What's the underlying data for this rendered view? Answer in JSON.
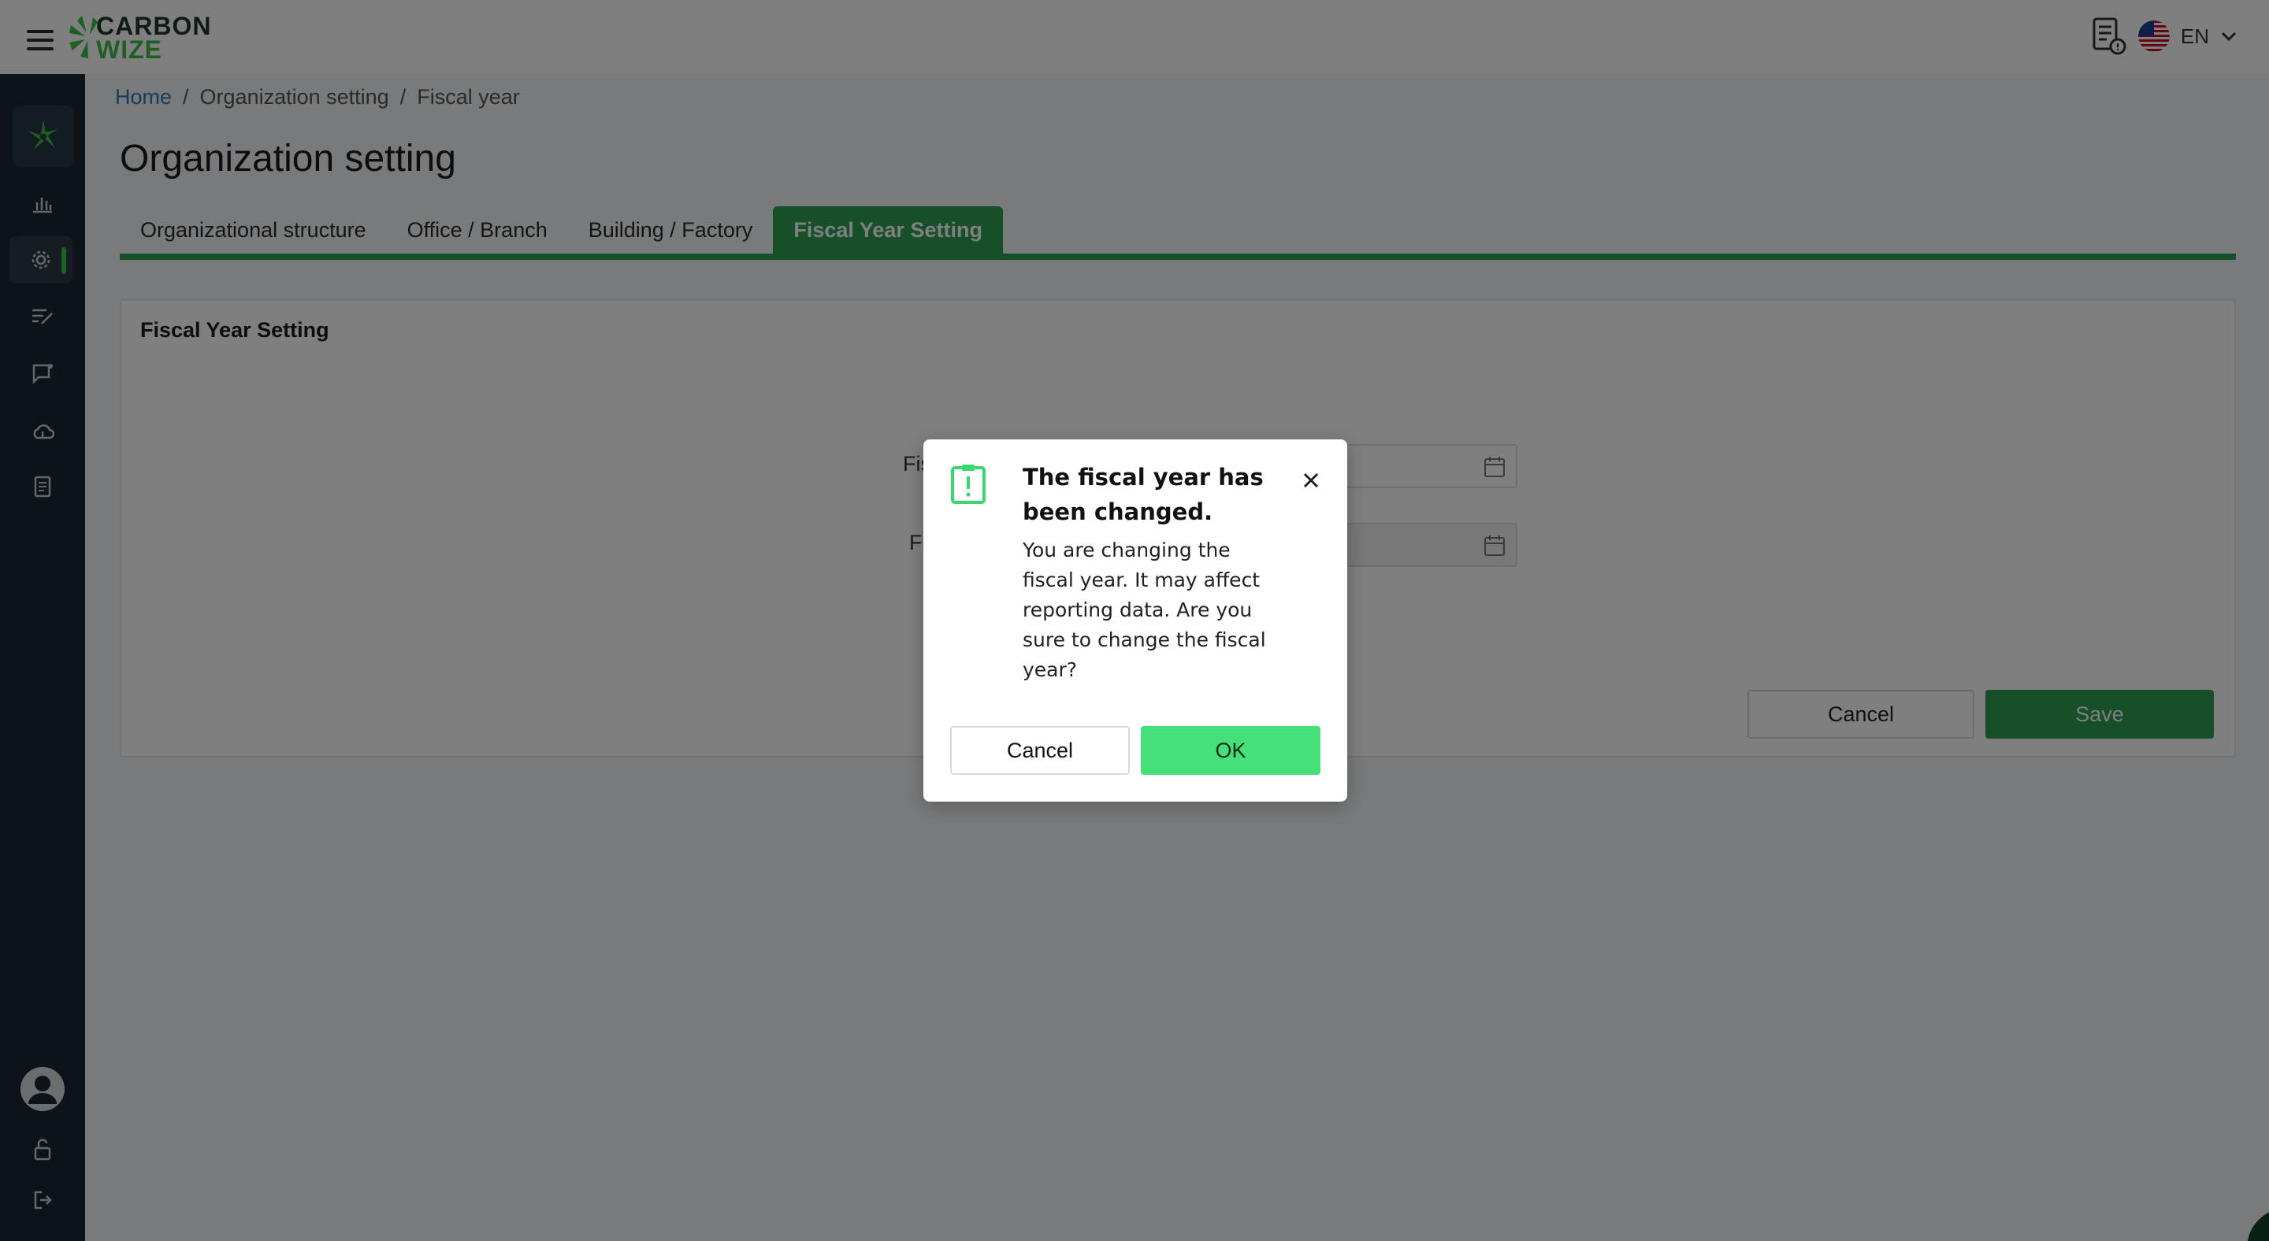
{
  "header": {
    "logo_line1": "CARBON",
    "logo_line2": "WIZE",
    "language": "EN"
  },
  "breadcrumb": {
    "items": [
      "Home",
      "/",
      "Organization setting",
      "/",
      "Fiscal year"
    ]
  },
  "page": {
    "title": "Organization setting"
  },
  "tabs": [
    {
      "label": "Organizational structure"
    },
    {
      "label": "Office / Branch"
    },
    {
      "label": "Building / Factory"
    },
    {
      "label": "Fiscal Year Setting"
    }
  ],
  "card": {
    "title": "Fiscal Year Setting",
    "field1_label_visible": "Fis",
    "field2_label_visible": "F",
    "cancel_label": "Cancel",
    "save_label": "Save"
  },
  "modal": {
    "title": "The fiscal year has been changed.",
    "body": "You are changing the fiscal year. It may affect reporting data. Are you sure to change the fiscal year?",
    "cancel_label": "Cancel",
    "ok_label": "OK"
  },
  "colors": {
    "brand_green": "#2f9e55",
    "ok_green": "#45e07a",
    "sidebar_bg": "#1b2731",
    "link_blue": "#2a7bb3"
  },
  "icons": {
    "header": [
      "menu-icon",
      "document-alert-icon",
      "us-flag-icon",
      "chevron-down-icon"
    ],
    "sidebar": [
      "dashboard-icon",
      "bar-chart-icon",
      "gear-icon",
      "edit-list-icon",
      "message-icon",
      "cloud-icon",
      "report-icon",
      "user-avatar-icon",
      "unlock-icon",
      "logout-icon"
    ]
  }
}
